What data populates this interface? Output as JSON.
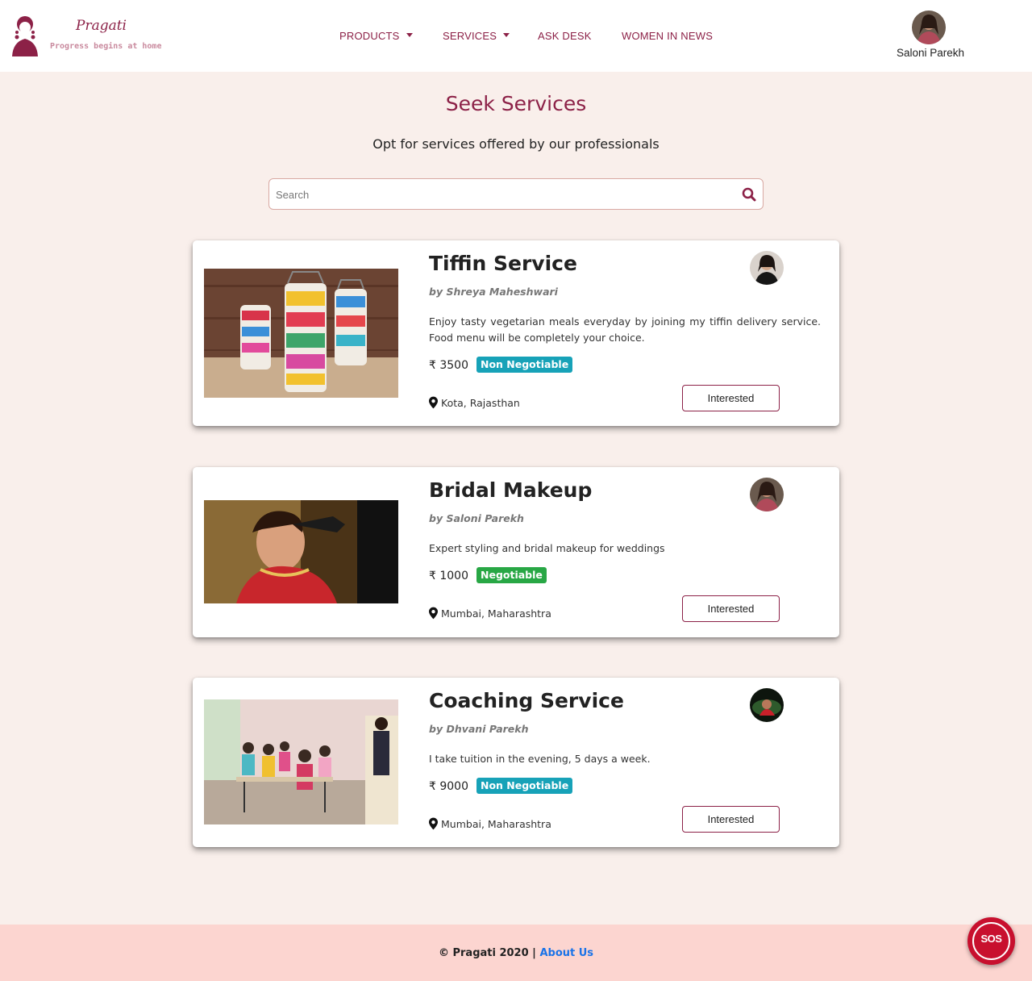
{
  "brand": {
    "name": "Pragati",
    "tagline": "Progress begins at home",
    "color": "#8c2147"
  },
  "nav": {
    "items": [
      {
        "label": "PRODUCTS",
        "dropdown": true
      },
      {
        "label": "SERVICES",
        "dropdown": true
      },
      {
        "label": "ASK DESK",
        "dropdown": false
      },
      {
        "label": "WOMEN IN NEWS",
        "dropdown": false
      }
    ]
  },
  "user": {
    "name": "Saloni Parekh"
  },
  "hero": {
    "title": "Seek Services",
    "subtitle": "Opt for services offered by our professionals"
  },
  "search": {
    "placeholder": "Search",
    "value": ""
  },
  "services": [
    {
      "title": "Tiffin Service",
      "author": "by Shreya Maheshwari",
      "description": "Enjoy tasty vegetarian meals everyday by joining my tiffin delivery service. Food menu will be completely your choice.",
      "price": "₹ 3500",
      "badge": "Non Negotiable",
      "badge_color": "#17a2b8",
      "location": "Kota, Rajasthan",
      "button": "Interested"
    },
    {
      "title": "Bridal Makeup",
      "author": "by Saloni Parekh",
      "description": "Expert styling and bridal makeup for weddings",
      "price": "₹ 1000",
      "badge": "Negotiable",
      "badge_color": "#28a745",
      "location": "Mumbai, Maharashtra",
      "button": "Interested"
    },
    {
      "title": "Coaching Service",
      "author": "by Dhvani Parekh",
      "description": "I take tuition in the evening, 5 days a week.",
      "price": "₹ 9000",
      "badge": "Non Negotiable",
      "badge_color": "#17a2b8",
      "location": "Mumbai, Maharashtra",
      "button": "Interested"
    }
  ],
  "footer": {
    "copyright": "© Pragati 2020 |",
    "link": "About Us"
  },
  "sos": {
    "label": "SOS",
    "color": "#c8102e"
  },
  "icons": [
    "logo-icon",
    "caret-down-icon",
    "search-icon",
    "map-pin-icon",
    "sos-icon"
  ]
}
